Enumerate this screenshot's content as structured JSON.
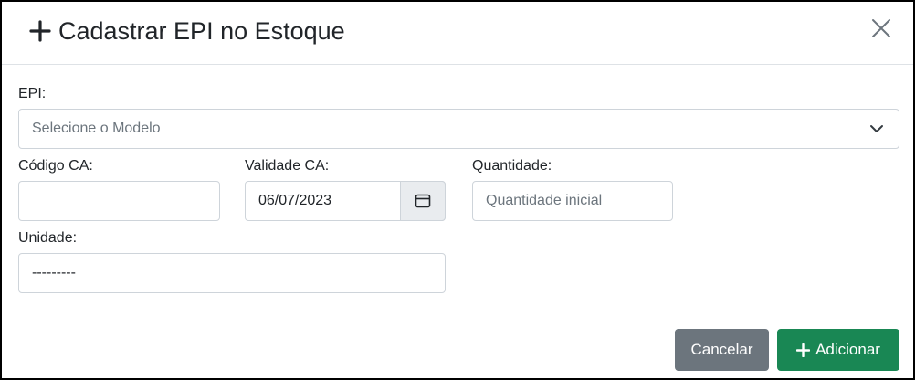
{
  "modal": {
    "title": "Cadastrar EPI no Estoque",
    "title_icon": "plus-icon",
    "close_icon": "close-icon"
  },
  "form": {
    "epi": {
      "label": "EPI:",
      "placeholder": "Selecione o Modelo",
      "icon": "chevron-down-icon"
    },
    "codigo_ca": {
      "label": "Código CA:",
      "value": ""
    },
    "validade_ca": {
      "label": "Validade CA:",
      "value": "06/07/2023",
      "icon": "calendar-icon"
    },
    "quantidade": {
      "label": "Quantidade:",
      "placeholder": "Quantidade inicial"
    },
    "unidade": {
      "label": "Unidade:",
      "value": "---------"
    }
  },
  "footer": {
    "cancel_label": "Cancelar",
    "add_label": "Adicionar",
    "add_icon": "plus-icon"
  },
  "colors": {
    "cancel_button": "#6c757d",
    "add_button": "#198754",
    "border": "#ced4da",
    "addon_background": "#e9ecef"
  }
}
